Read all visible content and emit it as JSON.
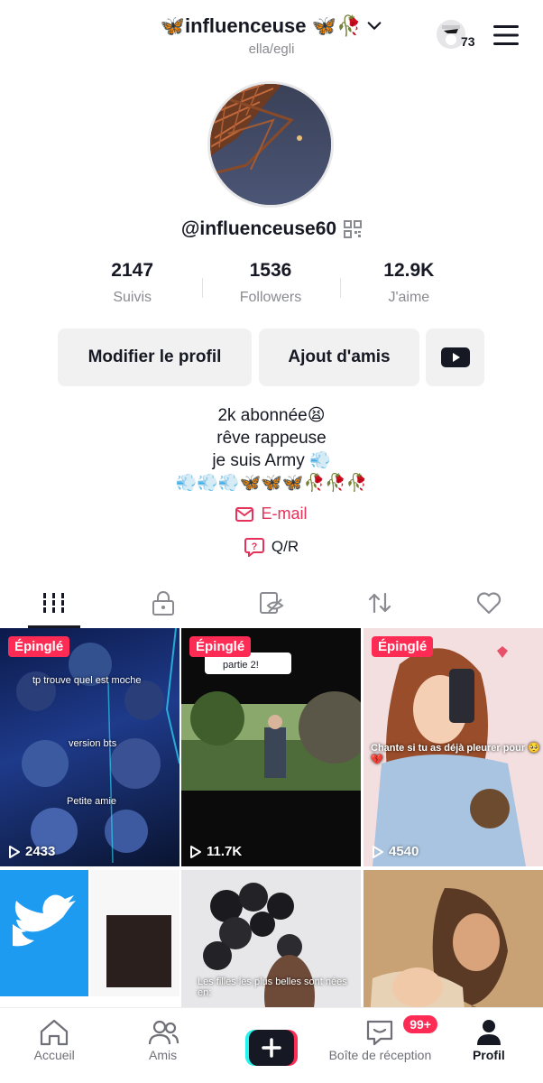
{
  "header": {
    "title": "🦋influenceuse 🦋🥀",
    "subtitle": "ella/egli",
    "viewer_count": "73"
  },
  "profile": {
    "username": "@influenceuse60",
    "stats": [
      {
        "value": "2147",
        "label": "Suivis"
      },
      {
        "value": "1536",
        "label": "Followers"
      },
      {
        "value": "12.9K",
        "label": "J'aime"
      }
    ],
    "edit_button": "Modifier le profil",
    "add_friends_button": "Ajout d'amis",
    "bio_lines": [
      "2k abonnée😫",
      "rêve rappeuse",
      "je suis Army 💨",
      "💨💨💨🦋🦋🦋🥀🥀🥀"
    ],
    "email_label": "E-mail",
    "qa_label": "Q/R"
  },
  "tabs": [
    "videos-tab",
    "private-tab",
    "hidden-tab",
    "reposts-tab",
    "liked-tab"
  ],
  "videos": [
    {
      "pinned": "Épinglé",
      "views": "2433",
      "captions": [
        "tp trouve  quel est moche",
        "version bts",
        "Petite  amie"
      ]
    },
    {
      "pinned": "Épinglé",
      "views": "11.7K",
      "captions": [
        "partie 2!"
      ]
    },
    {
      "pinned": "Épinglé",
      "views": "4540",
      "captions": [
        "Chante si tu as déjà pleurer pour 🥺💔"
      ]
    },
    {
      "pinned": "",
      "views": "",
      "captions": []
    },
    {
      "pinned": "",
      "views": "",
      "captions": [
        "Les filles les plus belles sont nées en:"
      ]
    },
    {
      "pinned": "",
      "views": "",
      "captions": []
    }
  ],
  "nav": {
    "home": "Accueil",
    "friends": "Amis",
    "inbox": "Boîte de réception",
    "inbox_badge": "99+",
    "profile": "Profil"
  },
  "colors": {
    "accent": "#fe2c55",
    "text": "#161823",
    "muted": "#8a8b91",
    "button_bg": "#f1f1f2"
  }
}
